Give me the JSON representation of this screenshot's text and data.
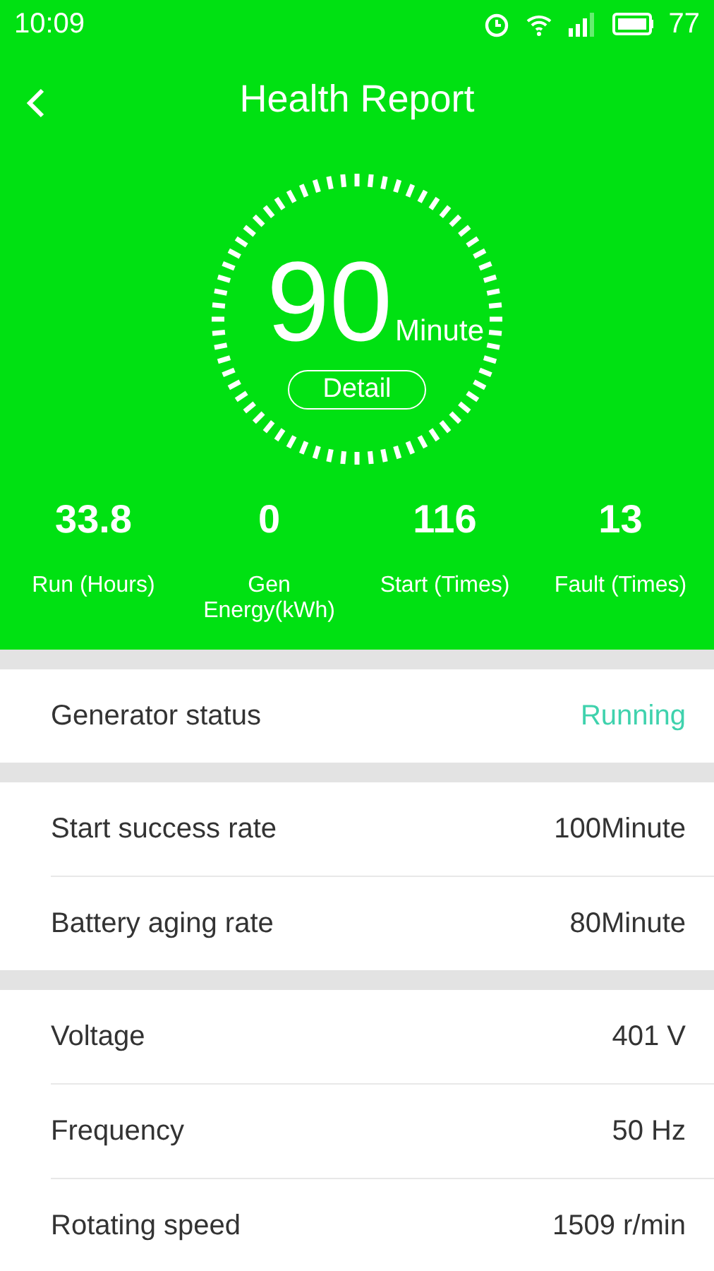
{
  "status_bar": {
    "time": "10:09",
    "battery": "77"
  },
  "header": {
    "title": "Health Report"
  },
  "gauge": {
    "value": "90",
    "unit": "Minute",
    "button": "Detail"
  },
  "stats": [
    {
      "value": "33.8",
      "label": "Run (Hours)"
    },
    {
      "value": "0",
      "label": "Gen Energy(kWh)"
    },
    {
      "value": "116",
      "label": "Start (Times)"
    },
    {
      "value": "13",
      "label": "Fault (Times)"
    }
  ],
  "sections": [
    {
      "rows": [
        {
          "label": "Generator status",
          "value": "Running",
          "kind": "status"
        }
      ]
    },
    {
      "rows": [
        {
          "label": "Start success rate",
          "value": "100Minute",
          "kind": "plain"
        },
        {
          "label": "Battery aging rate",
          "value": "80Minute",
          "kind": "plain"
        }
      ]
    },
    {
      "rows": [
        {
          "label": "Voltage",
          "value": "401 V",
          "kind": "plain"
        },
        {
          "label": "Frequency",
          "value": "50 Hz",
          "kind": "plain"
        },
        {
          "label": "Rotating speed",
          "value": "1509 r/min",
          "kind": "plain"
        }
      ]
    }
  ]
}
